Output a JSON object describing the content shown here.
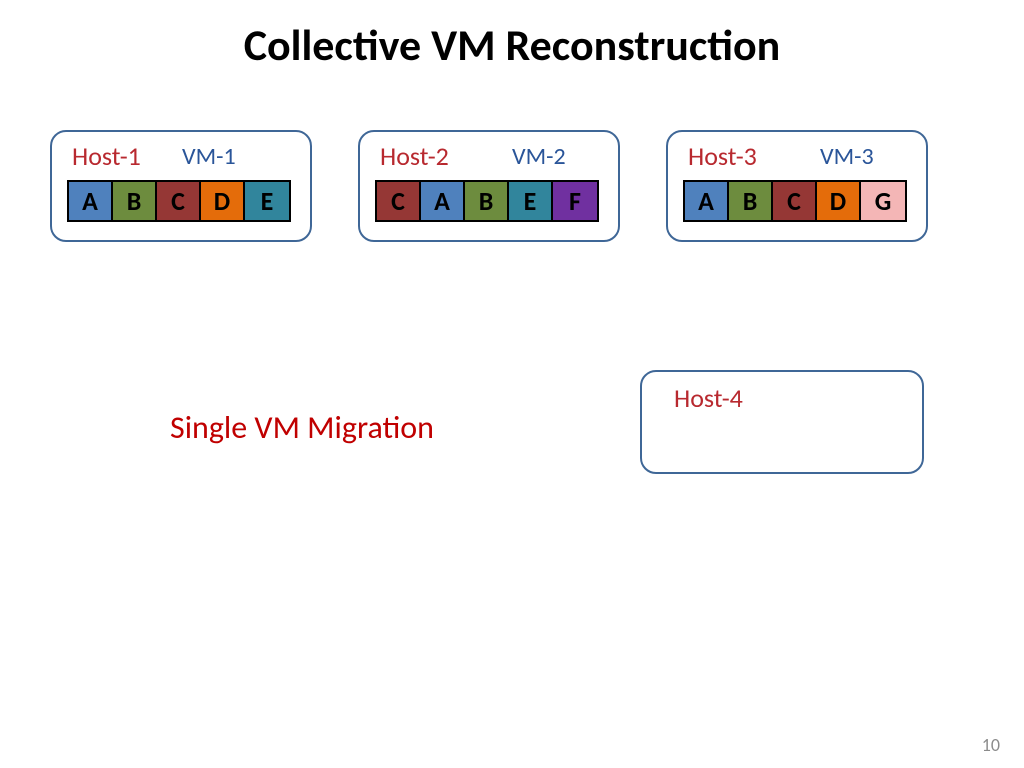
{
  "title": "Collective VM Reconstruction",
  "hosts": [
    {
      "host_label": "Host-1",
      "vm_label": "VM-1",
      "blocks": [
        {
          "label": "A",
          "color": "#4f81bd"
        },
        {
          "label": "B",
          "color": "#6d8c3e"
        },
        {
          "label": "C",
          "color": "#953735"
        },
        {
          "label": "D",
          "color": "#e46c0a"
        },
        {
          "label": "E",
          "color": "#31859c"
        }
      ]
    },
    {
      "host_label": "Host-2",
      "vm_label": "VM-2",
      "blocks": [
        {
          "label": "C",
          "color": "#953735"
        },
        {
          "label": "A",
          "color": "#4f81bd"
        },
        {
          "label": "B",
          "color": "#6d8c3e"
        },
        {
          "label": "E",
          "color": "#31859c"
        },
        {
          "label": "F",
          "color": "#7030a0"
        }
      ]
    },
    {
      "host_label": "Host-3",
      "vm_label": "VM-3",
      "blocks": [
        {
          "label": "A",
          "color": "#4f81bd"
        },
        {
          "label": "B",
          "color": "#6d8c3e"
        },
        {
          "label": "C",
          "color": "#953735"
        },
        {
          "label": "D",
          "color": "#e46c0a"
        },
        {
          "label": "G",
          "color": "#f4b6b6"
        }
      ]
    }
  ],
  "host4_label": "Host-4",
  "caption": "Single VM Migration",
  "page_number": "10"
}
